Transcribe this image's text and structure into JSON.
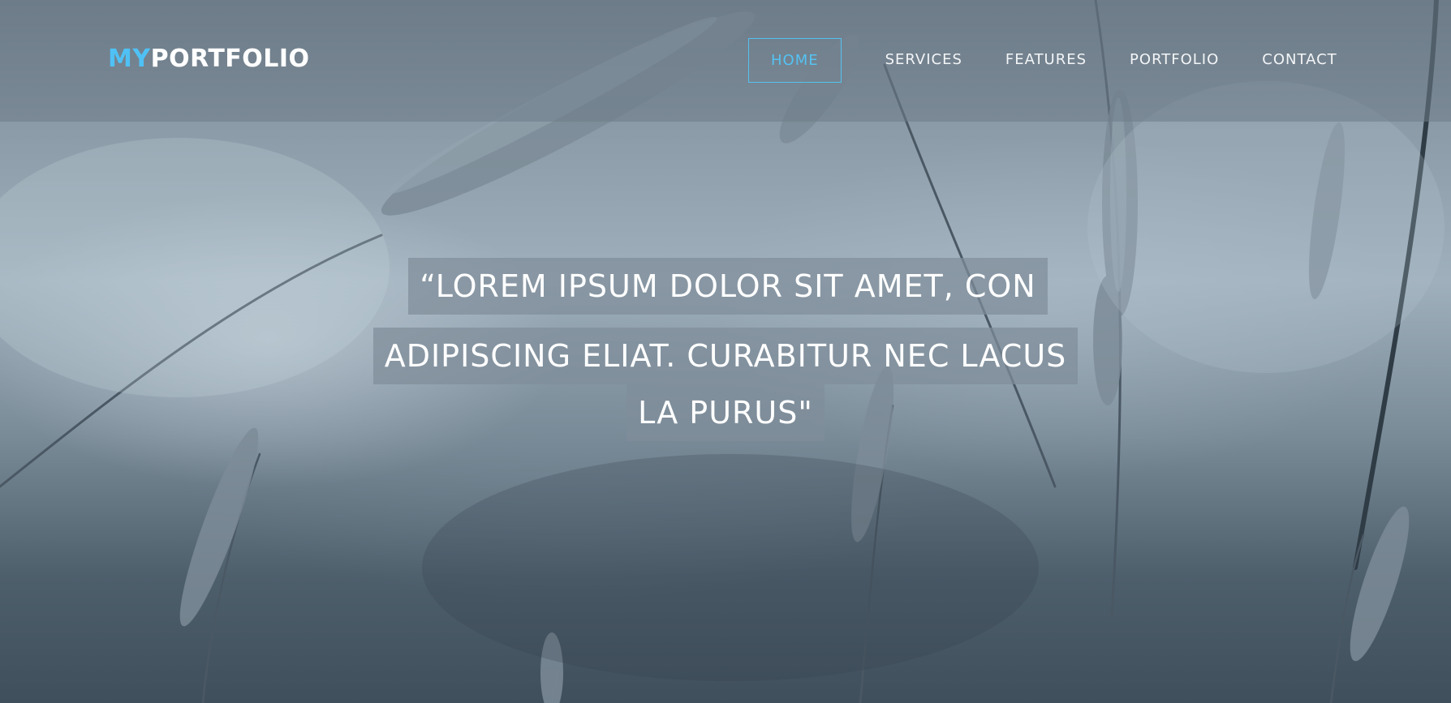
{
  "brand": {
    "accent_text": "MY",
    "main_text": "PORTFOLIO",
    "accent_color": "#4fc1f5"
  },
  "nav": {
    "items": [
      {
        "label": "HOME",
        "active": true
      },
      {
        "label": "SERVICES",
        "active": false
      },
      {
        "label": "FEATURES",
        "active": false
      },
      {
        "label": "PORTFOLIO",
        "active": false
      },
      {
        "label": "CONTACT",
        "active": false
      }
    ]
  },
  "hero": {
    "quote_lines": [
      "“LOREM IPSUM DOLOR SIT AMET, CON",
      "ADIPISCING ELIAT. CURABITUR NEC LACUS",
      "LA PURUS\""
    ]
  }
}
